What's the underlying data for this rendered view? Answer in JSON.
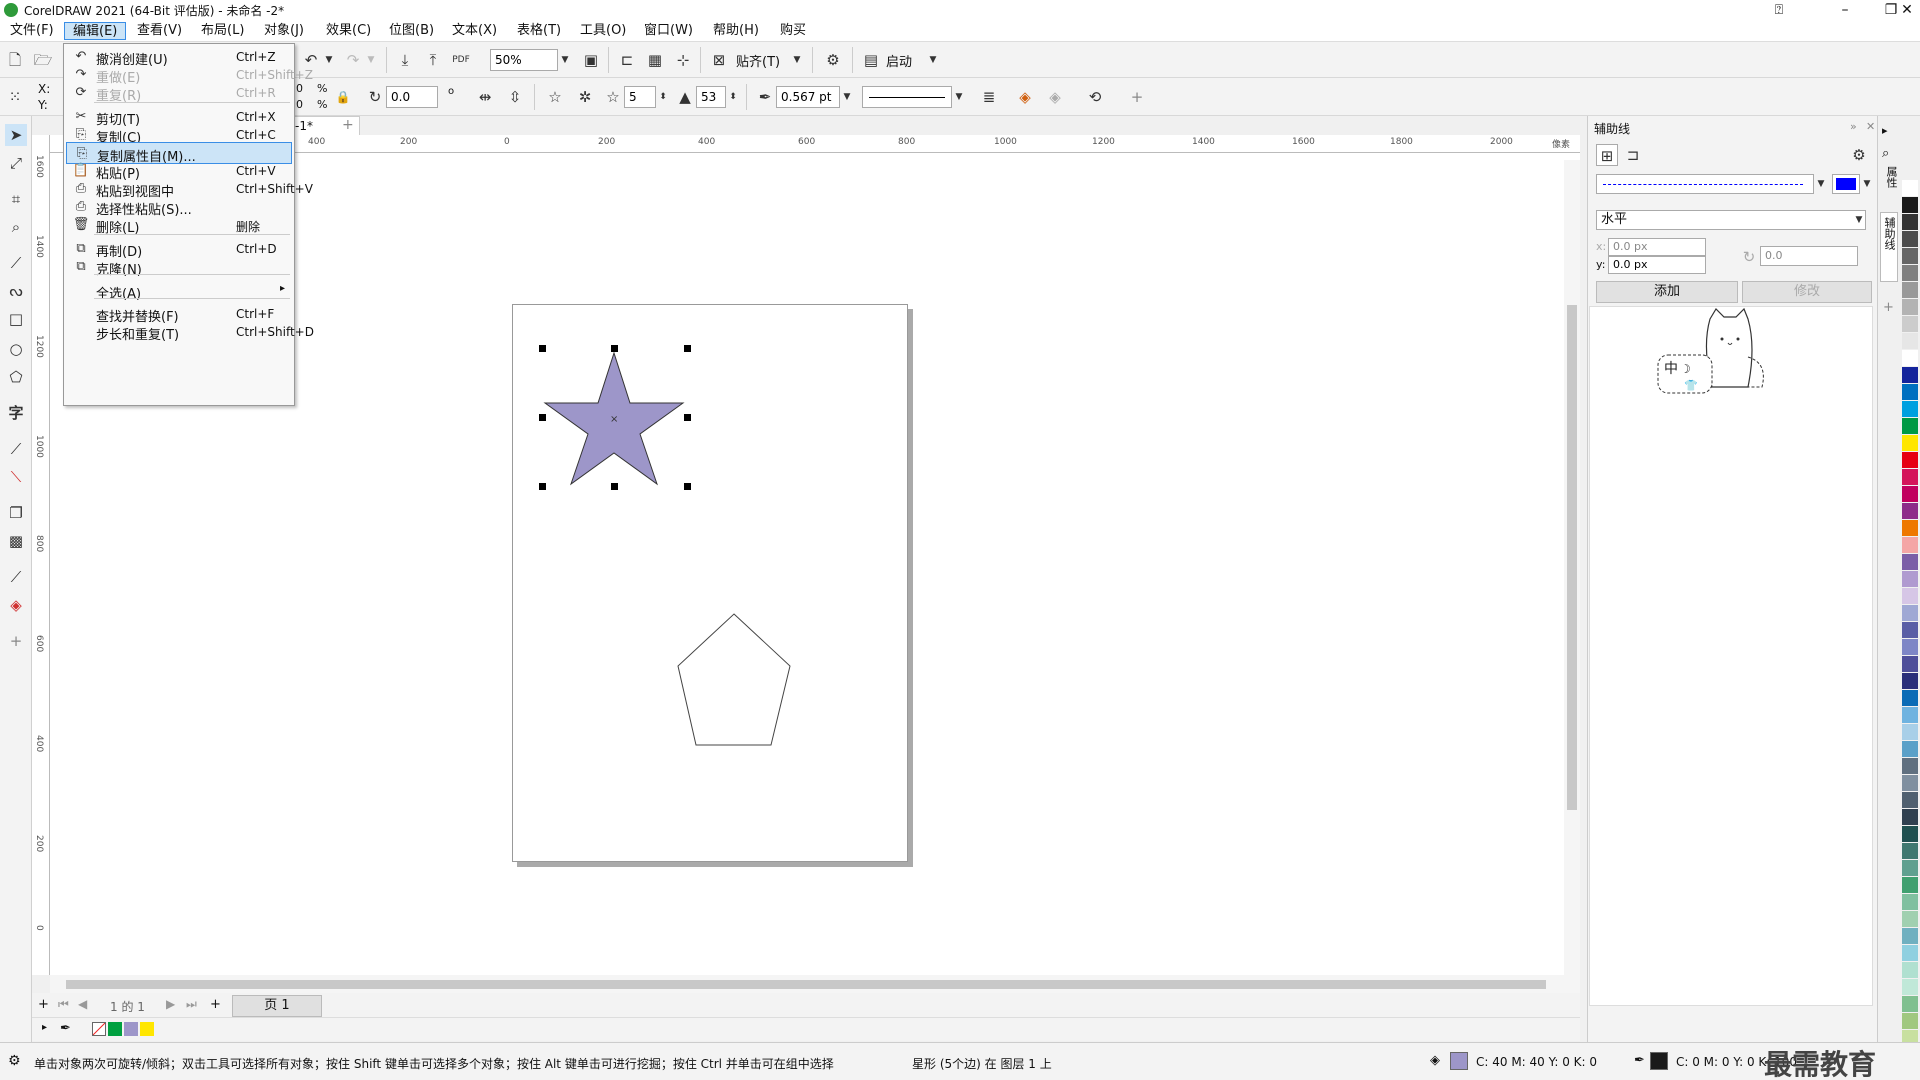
{
  "window": {
    "title": "CorelDRAW 2021 (64-Bit 评估版) - 未命名 -2*"
  },
  "menubar": [
    "文件(F)",
    "编辑(E)",
    "查看(V)",
    "布局(L)",
    "对象(J)",
    "效果(C)",
    "位图(B)",
    "文本(X)",
    "表格(T)",
    "工具(O)",
    "窗口(W)",
    "帮助(H)",
    "购买"
  ],
  "toolbar": {
    "zoom": "50%",
    "snap_label": "贴齐(T)",
    "launch_label": "启动",
    "x_label": "X:",
    "y_label": "Y:",
    "scale_x": "0",
    "scale_y": "0",
    "percent": "%",
    "degree_symbol": "o",
    "rotation": "0.0",
    "star_points": "5",
    "star_sharpness": "53",
    "outline_width": "0.567 pt"
  },
  "document": {
    "tab": "-1*"
  },
  "ruler": {
    "unit": "像素",
    "h_ticks": [
      "400",
      "200",
      "0",
      "200",
      "400",
      "600",
      "800",
      "1000",
      "1200",
      "1400",
      "1600",
      "1800",
      "2000"
    ],
    "v_ticks": [
      "1600",
      "1400",
      "1200",
      "1000",
      "800",
      "600",
      "400",
      "200",
      "0",
      "200",
      "400"
    ]
  },
  "colors": {
    "accent": "#3a8ee6",
    "star_fill": "#9d96c9",
    "highlight": "#cce4f7",
    "guide_color": "#0000ff"
  },
  "edit_menu": [
    {
      "label": "撤消创建(U)",
      "shortcut": "Ctrl+Z",
      "icon": "undo-icon",
      "disabled": false
    },
    {
      "label": "重做(E)",
      "shortcut": "Ctrl+Shift+Z",
      "icon": "redo-icon",
      "disabled": true
    },
    {
      "label": "重复(R)",
      "shortcut": "Ctrl+R",
      "icon": "repeat-icon",
      "disabled": true
    },
    {
      "label": "剪切(T)",
      "shortcut": "Ctrl+X",
      "icon": "cut-icon",
      "disabled": false
    },
    {
      "label": "复制(C)",
      "shortcut": "Ctrl+C",
      "icon": "copy-icon",
      "disabled": false
    },
    {
      "label": "复制属性自(M)...",
      "shortcut": "",
      "icon": "copy-properties-icon",
      "disabled": false
    },
    {
      "label": "粘贴(P)",
      "shortcut": "Ctrl+V",
      "icon": "paste-icon",
      "disabled": false
    },
    {
      "label": "粘贴到视图中",
      "shortcut": "Ctrl+Shift+V",
      "icon": "paste-in-view-icon",
      "disabled": false
    },
    {
      "label": "选择性粘贴(S)...",
      "shortcut": "",
      "icon": "paste-special-icon",
      "disabled": false
    },
    {
      "label": "删除(L)",
      "shortcut": "删除",
      "icon": "trash-icon",
      "disabled": false
    },
    {
      "label": "再制(D)",
      "shortcut": "Ctrl+D",
      "icon": "duplicate-icon",
      "disabled": false
    },
    {
      "label": "克隆(N)",
      "shortcut": "",
      "icon": "clone-icon",
      "disabled": false
    },
    {
      "label": "全选(A)",
      "shortcut": "",
      "icon": "",
      "disabled": false
    },
    {
      "label": "查找并替换(F)",
      "shortcut": "Ctrl+F",
      "icon": "",
      "disabled": false
    },
    {
      "label": "步长和重复(T)",
      "shortcut": "Ctrl+Shift+D",
      "icon": "",
      "disabled": false
    }
  ],
  "pagenav": {
    "page_of": "1 的 1",
    "page_tab": "页 1"
  },
  "docker": {
    "title": "辅助线",
    "orientation": "水平",
    "x_value": "0.0 px",
    "y_value": "0.0 px",
    "angle": "0.0",
    "add_label": "添加",
    "modify_label": "修改",
    "x_label": "x:",
    "y_label": "y:",
    "tab_properties": "属性",
    "tab_guides": "辅助线",
    "ime_label": "中"
  },
  "status": {
    "hint": "单击对象两次可旋转/倾斜；双击工具可选择所有对象；按住 Shift 键单击可选择多个对象；按住 Alt 键单击可进行挖掘；按住 Ctrl 并单击可在组中选择",
    "object_info": "星形 (5个边) 在 图层 1 上",
    "fill_info": "C: 40 M: 40 Y: 0 K: 0",
    "outline_info": "C: 0 M: 0 Y: 0 K: 100",
    "watermark": "最需教育"
  },
  "palette_colors": [
    "#ffffff",
    "#1a1a1a",
    "#333333",
    "#4d4d4d",
    "#666666",
    "#808080",
    "#999999",
    "#b3b3b3",
    "#cccccc",
    "#e6e6e6",
    "#ffffff",
    "#14249c",
    "#0070c0",
    "#00a0e0",
    "#009944",
    "#ffe600",
    "#e60012",
    "#d4145a",
    "#c1005f",
    "#8e2c8a",
    "#ee7800",
    "#f4a6a6",
    "#7b5ea7",
    "#b09ad0",
    "#d6c6e6",
    "#9fa8d4",
    "#5a5ea6",
    "#7e86c6",
    "#4f4f9a",
    "#2a2f7a",
    "#0a6bb6",
    "#6fb3e0",
    "#a8cfe8",
    "#5aa0c8",
    "#607080",
    "#8090a0",
    "#506070",
    "#304050",
    "#205050",
    "#407870",
    "#60a090",
    "#40a070",
    "#80c0a0",
    "#a0d0b0",
    "#70b0c0",
    "#90d0e0",
    "#b0e0d0",
    "#c0e8d8",
    "#80c090",
    "#a0c880",
    "#c8e0a0",
    "#e0f0c0"
  ]
}
